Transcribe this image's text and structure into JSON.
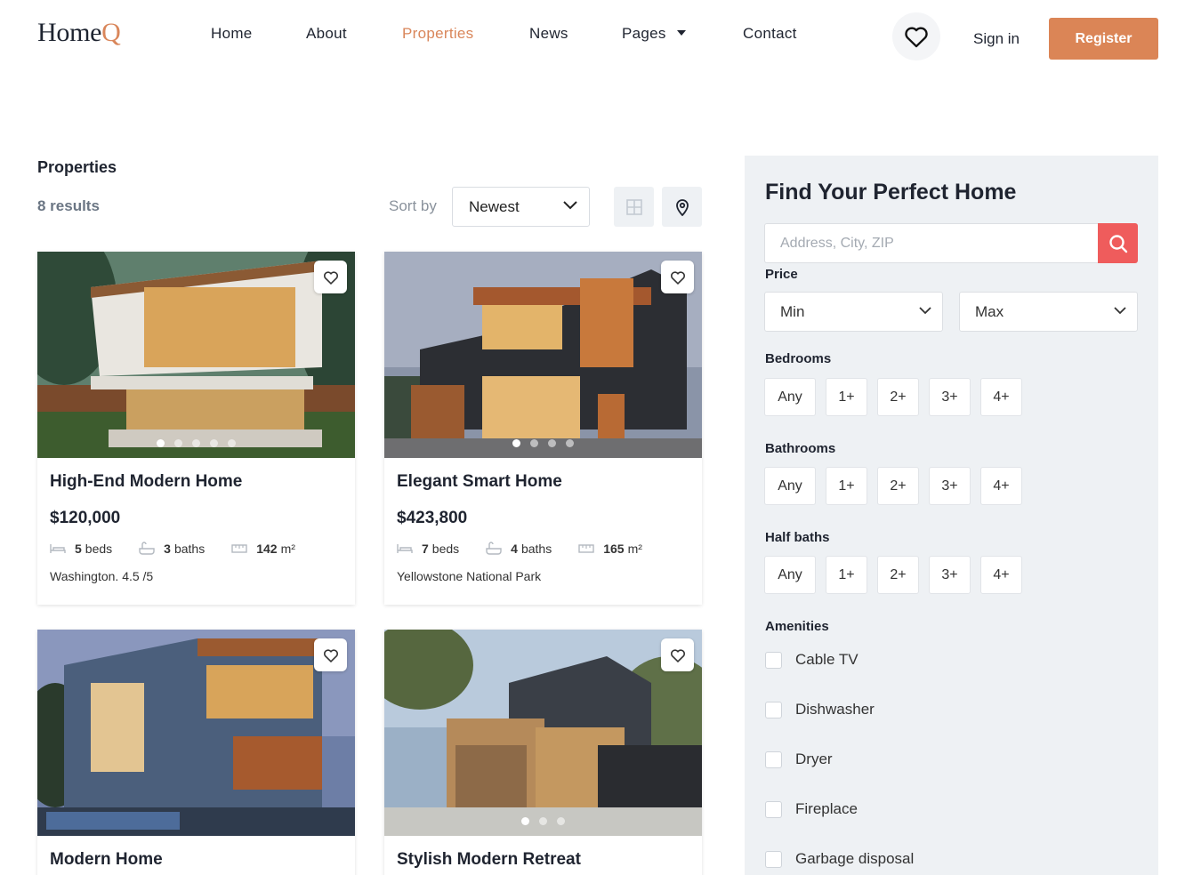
{
  "brand": {
    "name_main": "Home",
    "name_accent": "Q",
    "accent_color": "#d9865a"
  },
  "nav": {
    "items": [
      {
        "label": "Home",
        "active": false
      },
      {
        "label": "About",
        "active": false
      },
      {
        "label": "Properties",
        "active": true
      },
      {
        "label": "News",
        "active": false
      },
      {
        "label": "Pages",
        "active": false,
        "has_dropdown": true
      },
      {
        "label": "Contact",
        "active": false
      }
    ],
    "favorites_icon": "heart-icon",
    "signin_label": "Sign in",
    "register_label": "Register",
    "register_color": "#db8556"
  },
  "listing": {
    "title": "Properties",
    "results_text": "8 results",
    "sort_label": "Sort by",
    "sort_value": "Newest",
    "view_icons": [
      "grid-icon",
      "map-pin-icon"
    ]
  },
  "cards": [
    {
      "name": "High-End Modern Home",
      "price": "$120,000",
      "beds": "5",
      "beds_label": "beds",
      "baths": "3",
      "baths_label": "baths",
      "area": "142",
      "area_unit": "m²",
      "location": "Washington. 4.5 /5",
      "dots": 5,
      "active_dot": 0
    },
    {
      "name": "Elegant Smart Home",
      "price": "$423,800",
      "beds": "7",
      "beds_label": "beds",
      "baths": "4",
      "baths_label": "baths",
      "area": "165",
      "area_unit": "m²",
      "location": "Yellowstone National Park",
      "dots": 4,
      "active_dot": 0
    },
    {
      "name": "Modern Home",
      "price": "",
      "location": "",
      "dots": 0,
      "active_dot": 0
    },
    {
      "name": "Stylish Modern Retreat",
      "price": "",
      "location": "",
      "dots": 3,
      "active_dot": 0
    }
  ],
  "sidebar": {
    "title": "Find Your Perfect Home",
    "search_placeholder": "Address, City, ZIP",
    "search_color": "#ef5c5c",
    "price_label": "Price",
    "price_min": "Min",
    "price_max": "Max",
    "bedrooms_label": "Bedrooms",
    "bathrooms_label": "Bathrooms",
    "halfbaths_label": "Half baths",
    "options": [
      "Any",
      "1+",
      "2+",
      "3+",
      "4+"
    ],
    "amenities_label": "Amenities",
    "amenities": [
      "Cable TV",
      "Dishwasher",
      "Dryer",
      "Fireplace",
      "Garbage disposal"
    ]
  }
}
